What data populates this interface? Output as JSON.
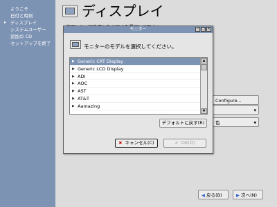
{
  "sidebar": {
    "items": [
      {
        "label": "ようこそ"
      },
      {
        "label": "日付と時刻"
      },
      {
        "label": "ディスプレイ"
      },
      {
        "label": "システムユーザー"
      },
      {
        "label": "追加の CD"
      },
      {
        "label": "セットアップを終了"
      }
    ],
    "active_index": 2
  },
  "header": {
    "title": "ディスプレイ",
    "instruction": "使用したい解像度と色の深さを選択して下さい。"
  },
  "background": {
    "configure_label": "Configure...",
    "combo1_value": "",
    "combo2_value": "色"
  },
  "dialog": {
    "title": "モニター",
    "prompt": "モニターのモデルを選択してください。",
    "monitors": [
      "Generic CRT Display",
      "Generic LCD Display",
      "ADI",
      "AOC",
      "AST",
      "AT&T",
      "Aamazing"
    ],
    "selected_index": 0,
    "default_button": "デフォルトに戻す(R)",
    "cancel_button": "キャンセル(C)",
    "ok_button": "OK(O)"
  },
  "nav": {
    "back_label": "戻る(B)",
    "next_label": "次へ(N)"
  },
  "colors": {
    "sidebar_bg": "#7d93b3",
    "selection": "#7d93b3"
  }
}
